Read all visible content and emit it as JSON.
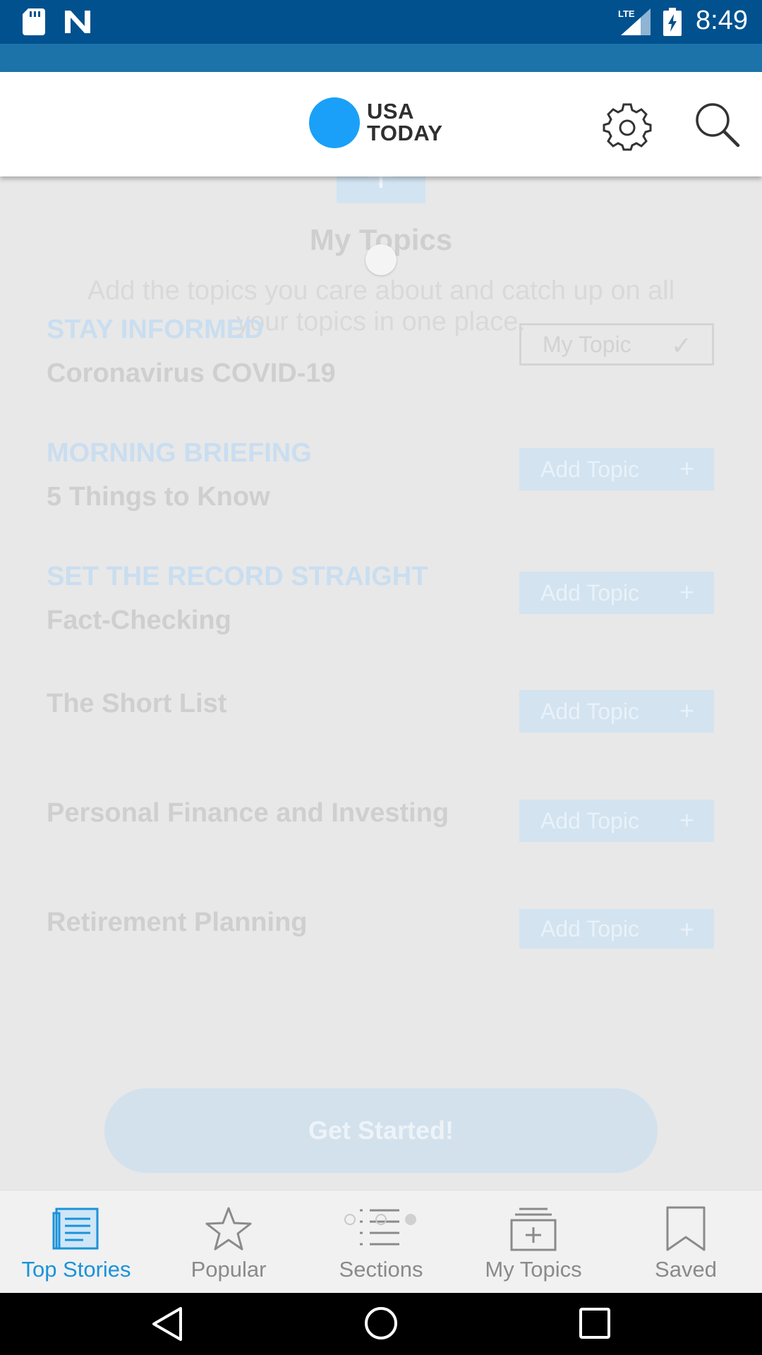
{
  "status_bar": {
    "time": "8:49",
    "network": "LTE",
    "icons": [
      "sd-card-icon",
      "n-notification-icon",
      "lte-signal-icon",
      "battery-charging-icon"
    ]
  },
  "header": {
    "logo_line1": "USA",
    "logo_line2": "TODAY",
    "icons": [
      "gear-icon",
      "search-icon"
    ]
  },
  "main": {
    "plus_symbol": "+",
    "title": "My Topics",
    "description": "Add the topics you care about and catch up on all your topics in one place.",
    "topics": [
      {
        "kicker": "STAY INFORMED",
        "name": "Coronavirus COVID-19",
        "button": "My Topic",
        "button_symbol": "✓",
        "selected": true
      },
      {
        "kicker": "MORNING BRIEFING",
        "name": "5 Things to Know",
        "button": "Add Topic",
        "button_symbol": "+",
        "selected": false
      },
      {
        "kicker": "SET THE RECORD STRAIGHT",
        "name": "Fact-Checking",
        "button": "Add Topic",
        "button_symbol": "+",
        "selected": false
      },
      {
        "kicker": "",
        "name": "The Short List",
        "button": "Add Topic",
        "button_symbol": "+",
        "selected": false
      },
      {
        "kicker": "",
        "name": "Personal Finance and Investing",
        "button": "Add Topic",
        "button_symbol": "+",
        "selected": false
      },
      {
        "kicker": "",
        "name": "Retirement Planning",
        "button": "Add Topic",
        "button_symbol": "+",
        "selected": false
      }
    ],
    "cta": "Get Started!"
  },
  "bottom_nav": {
    "items": [
      {
        "label": "Top Stories",
        "icon": "newspaper-icon",
        "active": true
      },
      {
        "label": "Popular",
        "icon": "star-icon",
        "active": false
      },
      {
        "label": "Sections",
        "icon": "list-icon",
        "active": false
      },
      {
        "label": "My Topics",
        "icon": "add-folder-icon",
        "active": false
      },
      {
        "label": "Saved",
        "icon": "bookmark-icon",
        "active": false
      }
    ]
  },
  "colors": {
    "status_bar": "#01518f",
    "accent": "#1a93d9",
    "logo": "#1aa0f8"
  }
}
